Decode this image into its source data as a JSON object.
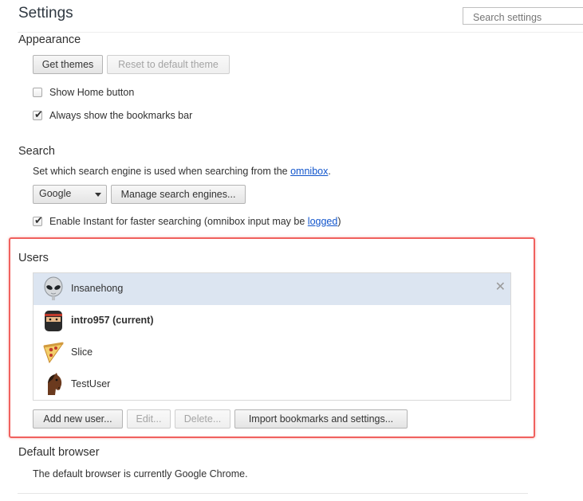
{
  "header": {
    "title": "Settings",
    "search_placeholder": "Search settings"
  },
  "appearance": {
    "heading": "Appearance",
    "get_themes_label": "Get themes",
    "reset_theme_label": "Reset to default theme",
    "show_home_label": "Show Home button",
    "show_home_checked": false,
    "bookmarks_bar_label": "Always show the bookmarks bar",
    "bookmarks_bar_checked": true
  },
  "search": {
    "heading": "Search",
    "description_prefix": "Set which search engine is used when searching from the ",
    "description_link": "omnibox",
    "description_suffix": ".",
    "engine_selected": "Google",
    "manage_label": "Manage search engines...",
    "instant_label_prefix": "Enable Instant for faster searching (omnibox input may be ",
    "instant_link": "logged",
    "instant_label_suffix": ")",
    "instant_checked": true
  },
  "users": {
    "heading": "Users",
    "list": [
      {
        "name": "Insanehong",
        "avatar": "alien-avatar-icon",
        "selected": true,
        "current": false
      },
      {
        "name": "intro957 (current)",
        "avatar": "ninja-avatar-icon",
        "selected": false,
        "current": true
      },
      {
        "name": "Slice",
        "avatar": "pizza-avatar-icon",
        "selected": false,
        "current": false
      },
      {
        "name": "TestUser",
        "avatar": "horse-avatar-icon",
        "selected": false,
        "current": false
      }
    ],
    "add_label": "Add new user...",
    "edit_label": "Edit...",
    "delete_label": "Delete...",
    "import_label": "Import bookmarks and settings...",
    "highlight_color": "#f0615e"
  },
  "default_browser": {
    "heading": "Default browser",
    "description": "The default browser is currently Google Chrome."
  }
}
